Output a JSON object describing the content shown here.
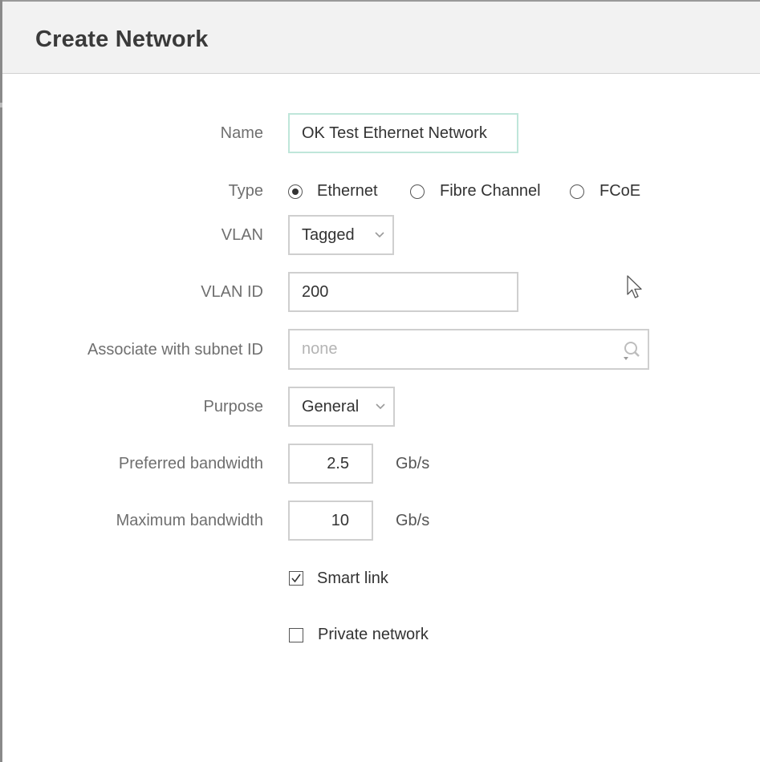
{
  "dialog": {
    "title": "Create Network"
  },
  "form": {
    "name": {
      "label": "Name",
      "value": "OK Test Ethernet Network"
    },
    "type": {
      "label": "Type",
      "options": [
        "Ethernet",
        "Fibre Channel",
        "FCoE"
      ],
      "selected": "Ethernet"
    },
    "vlan": {
      "label": "VLAN",
      "value": "Tagged"
    },
    "vlan_id": {
      "label": "VLAN ID",
      "value": "200"
    },
    "subnet": {
      "label": "Associate with subnet ID",
      "placeholder": "none"
    },
    "purpose": {
      "label": "Purpose",
      "value": "General"
    },
    "preferred_bandwidth": {
      "label": "Preferred bandwidth",
      "value": "2.5",
      "unit": "Gb/s"
    },
    "maximum_bandwidth": {
      "label": "Maximum bandwidth",
      "value": "10",
      "unit": "Gb/s"
    },
    "smart_link": {
      "label": "Smart link",
      "checked": true
    },
    "private_network": {
      "label": "Private network",
      "checked": false
    }
  },
  "icons": {
    "search": "search-icon",
    "cursor": "mouse-cursor-icon",
    "chevron": "chevron-down-icon"
  }
}
